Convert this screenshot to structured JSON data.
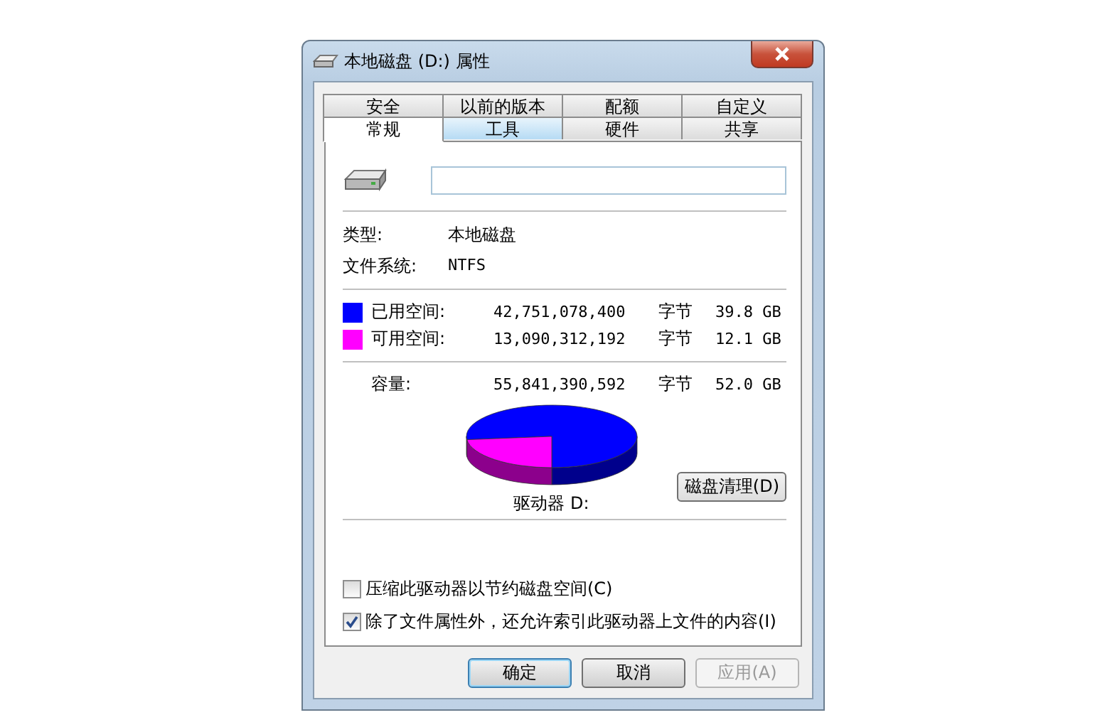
{
  "window": {
    "title": "本地磁盘 (D:) 属性"
  },
  "tabs_back": [
    {
      "label": "安全",
      "selected": false
    },
    {
      "label": "以前的版本",
      "selected": false
    },
    {
      "label": "配额",
      "selected": false
    },
    {
      "label": "自定义",
      "selected": false
    }
  ],
  "tabs_front": [
    {
      "label": "常规",
      "selected": true,
      "highlighted": false
    },
    {
      "label": "工具",
      "selected": false,
      "highlighted": true
    },
    {
      "label": "硬件",
      "selected": false,
      "highlighted": false
    },
    {
      "label": "共享",
      "selected": false,
      "highlighted": false
    }
  ],
  "info": [
    {
      "label": "类型:",
      "value": "本地磁盘"
    },
    {
      "label": "文件系统:",
      "value": "NTFS"
    }
  ],
  "space": [
    {
      "label": "已用空间:",
      "bytes": "42,751,078,400",
      "unit": "字节",
      "size": "39.8 GB",
      "color": "#0000ff"
    },
    {
      "label": "可用空间:",
      "bytes": "13,090,312,192",
      "unit": "字节",
      "size": "12.1 GB",
      "color": "#ff00ff"
    }
  ],
  "capacity": {
    "label": "容量:",
    "bytes": "55,841,390,592",
    "unit": "字节",
    "size": "52.0 GB"
  },
  "drive_label": "驱动器 D:",
  "cleanup_button": "磁盘清理(D)",
  "options": [
    {
      "label": "压缩此驱动器以节约磁盘空间(C)",
      "checked": false
    },
    {
      "label": "除了文件属性外，还允许索引此驱动器上文件的内容(I)",
      "checked": true
    }
  ],
  "buttons": [
    {
      "label": "确定",
      "default": true,
      "disabled": false
    },
    {
      "label": "取消",
      "default": false,
      "disabled": false
    },
    {
      "label": "应用(A)",
      "default": false,
      "disabled": true
    }
  ]
}
